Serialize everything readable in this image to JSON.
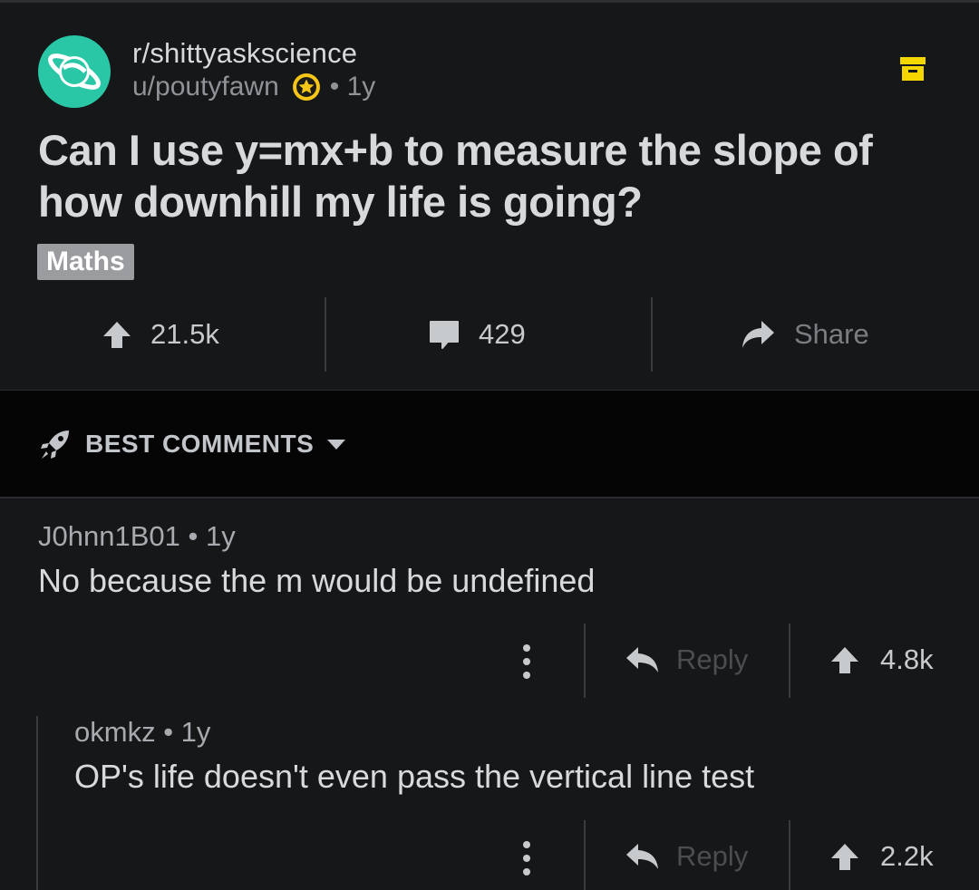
{
  "post": {
    "subreddit": "r/shittyaskscience",
    "author": "u/poutyfawn",
    "age": "• 1y",
    "title": "Can I use y=mx+b to measure the slope of how downhill my life is going?",
    "flair": "Maths",
    "upvotes": "21.5k",
    "comments": "429",
    "share_label": "Share"
  },
  "sort": {
    "label": "BEST COMMENTS"
  },
  "comments": [
    {
      "author": "J0hnn1B01",
      "age": "• 1y",
      "body": "No because the m would be undefined",
      "reply_label": "Reply",
      "votes": "4.8k"
    },
    {
      "author": "okmkz",
      "age": "• 1y",
      "body": "OP's life doesn't even pass the vertical line test",
      "reply_label": "Reply",
      "votes": "2.2k"
    }
  ],
  "colors": {
    "background": "#151619",
    "subreddit_avatar": "#29c7a6",
    "award_gold": "#f5c518",
    "archive_icon": "#f5d700"
  }
}
